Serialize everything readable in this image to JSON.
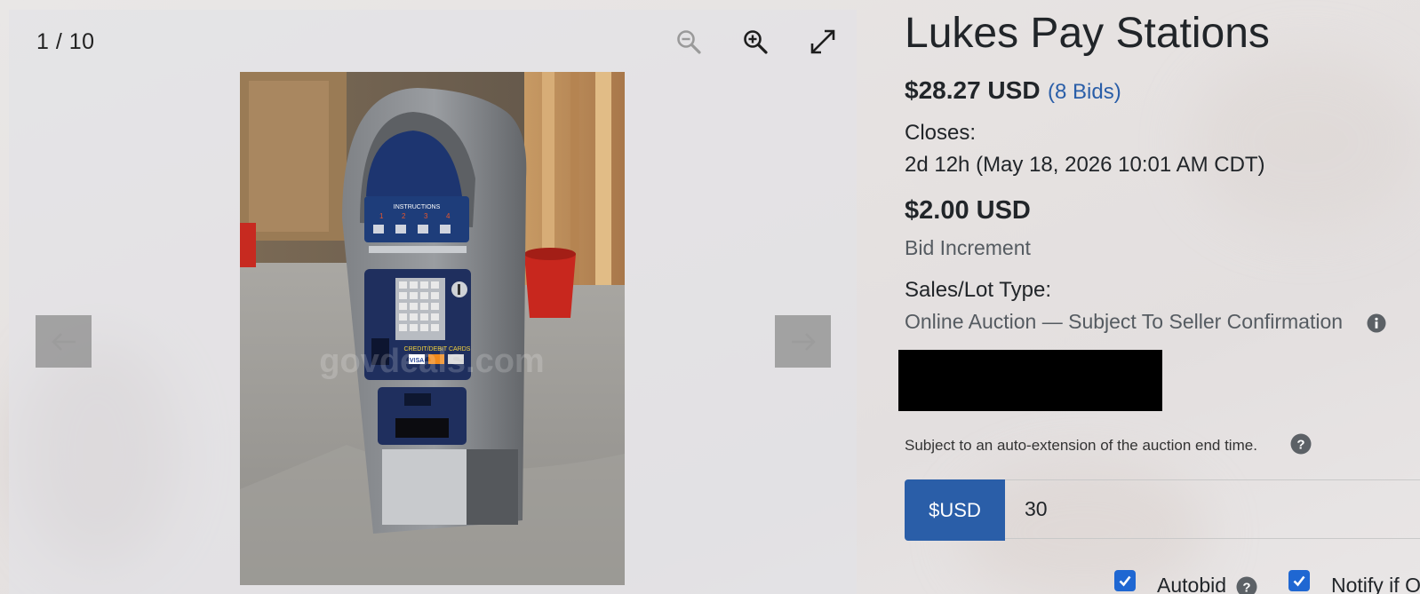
{
  "gallery": {
    "counter": "1 / 10",
    "watermark": "govdeals.com"
  },
  "photo_labels": {
    "instructions": "INSTRUCTIONS",
    "steps": [
      "1",
      "2",
      "3",
      "4"
    ],
    "cards": "CREDIT/DEBIT CARDS",
    "visa": "VISA"
  },
  "listing": {
    "title": "Lukes Pay Stations",
    "price": "$28.27 USD",
    "bids": "(8 Bids)",
    "closes_label": "Closes:",
    "closes_value": "2d 12h (May 18, 2026 10:01 AM CDT)",
    "increment_value": "$2.00 USD",
    "increment_label": "Bid Increment",
    "sale_type_label": "Sales/Lot Type:",
    "sale_type_value": "Online Auction — Subject To Seller Confirmation",
    "auto_extension": "Subject to an auto-extension of the auction end time."
  },
  "bid_form": {
    "currency_label": "$USD",
    "amount": "30",
    "autobid_label": "Autobid",
    "notify_label": "Notify if O"
  },
  "colors": {
    "primary": "#2a5ea8",
    "checkbox": "#1f67d2",
    "redaction": "#000000"
  },
  "icons": [
    "zoom-out-icon",
    "zoom-in-icon",
    "fullscreen-icon",
    "arrow-left-icon",
    "arrow-right-icon",
    "info-icon",
    "question-icon",
    "checkmark-icon"
  ]
}
